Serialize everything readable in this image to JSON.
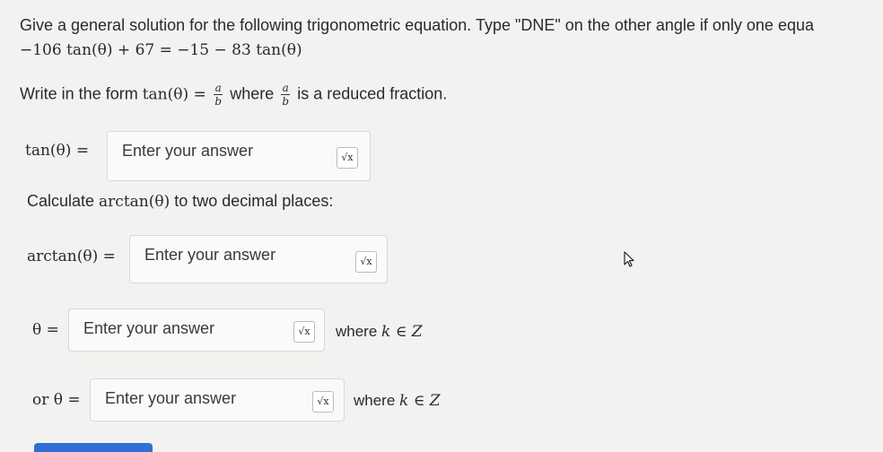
{
  "question": {
    "instruction": "Give a general solution for the following trigonometric equation. Type \"DNE\" on the other angle if only one equa",
    "equation": "−106 tan(θ) + 67 = −15 − 83 tan(θ)",
    "form_prefix": "Write in the form ",
    "form_mid": "tan(θ) = ",
    "form_where": " where ",
    "form_suffix": " is a reduced fraction.",
    "frac_num": "a",
    "frac_den": "b"
  },
  "tan_field": {
    "label": "tan(θ) =",
    "placeholder": "Enter your answer"
  },
  "arctan_prompt": {
    "prefix": "Calculate ",
    "math": "arctan(θ)",
    "suffix": " to two decimal places:"
  },
  "arctan_field": {
    "label": "arctan(θ) =",
    "placeholder": "Enter your answer"
  },
  "theta_field": {
    "label": "θ =",
    "placeholder": "Enter your answer",
    "where": "where ",
    "where_math": "k ∈ Z"
  },
  "theta2_field": {
    "label": "or θ =",
    "placeholder": "Enter your answer",
    "where": "where ",
    "where_math": "k ∈ Z"
  },
  "sqrt_button_label": "√x",
  "colors": {
    "accent": "#2f6fd6",
    "background": "#f3f2f0"
  }
}
